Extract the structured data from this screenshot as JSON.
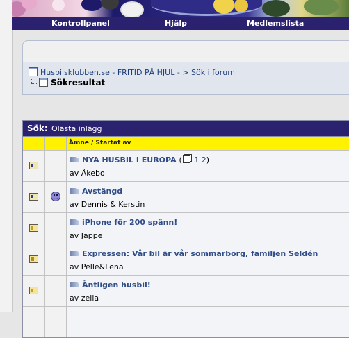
{
  "nav": {
    "items": [
      {
        "label": "Kontrollpanel"
      },
      {
        "label": "Hjälp"
      },
      {
        "label": "Medlemslista"
      }
    ]
  },
  "breadcrumb": {
    "site": "Husbilsklubben.se - FRITID PÅ HJUL -",
    "separator": ">",
    "section": "Sök i forum",
    "current": "Sökresultat"
  },
  "results": {
    "header_label": "Sök:",
    "header_value": "Olästa inlägg",
    "column_title": "Ämne / Startat av",
    "author_prefix": "av",
    "rows": [
      {
        "title": "NYA HUSBIL I EUROPA",
        "author": "Åkebo",
        "pages": [
          "1",
          "2"
        ],
        "page_open": "(",
        "page_close": ")",
        "smiley": false
      },
      {
        "title": "Avstängd",
        "author": "Dennis & Kerstin",
        "smiley": true
      },
      {
        "title": "iPhone för 200 spänn!",
        "author": "Jappe",
        "smiley": false
      },
      {
        "title": "Expressen: Vår bil är vår sommarborg, familjen Seldén",
        "author": "Pelle&Lena",
        "smiley": false
      },
      {
        "title": "Äntligen husbil!",
        "author": "zeila",
        "smiley": false
      }
    ]
  },
  "colors": {
    "navbar": "#2a216f",
    "column_header": "#fff200",
    "link": "#2f4c86"
  }
}
